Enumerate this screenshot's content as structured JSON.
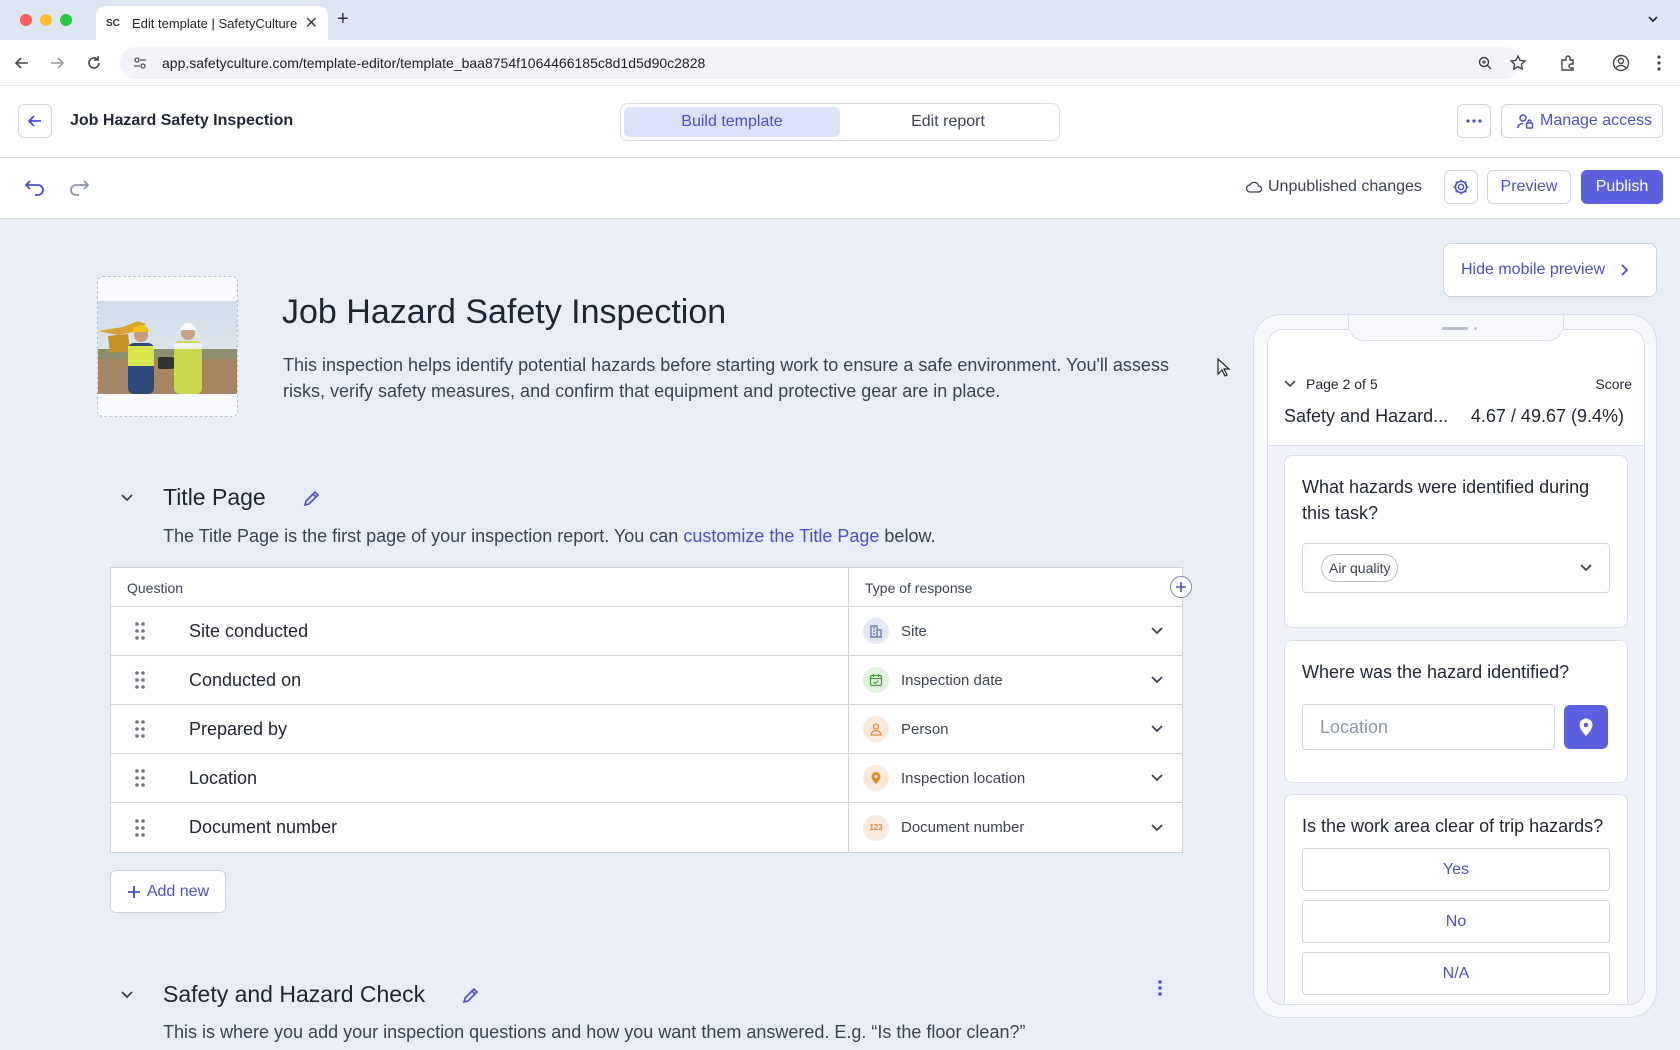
{
  "browser": {
    "tab_title": "Edit template | SafetyCulture",
    "tab_favicon": "SC",
    "url": "app.safetyculture.com/template-editor/template_baa8754f1064466185c8d1d5d90c2828"
  },
  "header": {
    "title": "Job Hazard Safety Inspection",
    "tabs": [
      {
        "label": "Build template",
        "active": true
      },
      {
        "label": "Edit report",
        "active": false
      }
    ],
    "manage_access": "Manage access"
  },
  "toolbar": {
    "status": "Unpublished changes",
    "preview_label": "Preview",
    "publish_label": "Publish"
  },
  "template": {
    "title": "Job Hazard Safety Inspection",
    "description": "This inspection helps identify potential hazards before starting work to ensure a safe environment. You'll assess risks, verify safety measures, and confirm that equipment and protective gear are in place."
  },
  "title_page": {
    "title": "Title Page",
    "desc_prefix": "The Title Page is the first page of your inspection report. You can ",
    "desc_link": "customize the Title Page",
    "desc_suffix": " below.",
    "col_question": "Question",
    "col_type": "Type of response",
    "rows": [
      {
        "question": "Site conducted",
        "type": "Site",
        "icon": "building-icon"
      },
      {
        "question": "Conducted on",
        "type": "Inspection date",
        "icon": "calendar-icon"
      },
      {
        "question": "Prepared by",
        "type": "Person",
        "icon": "person-icon"
      },
      {
        "question": "Location",
        "type": "Inspection location",
        "icon": "pin-icon"
      },
      {
        "question": "Document number",
        "type": "Document number",
        "icon": "number-icon"
      }
    ],
    "add_new": "Add new"
  },
  "safety_section": {
    "title": "Safety and Hazard Check",
    "description": "This is where you add your inspection questions and how you want them answered. E.g. “Is the floor clean?”"
  },
  "mobile_preview": {
    "hide_label": "Hide mobile preview",
    "page_indicator": "Page 2 of 5",
    "score_label": "Score",
    "section_title": "Safety and Hazard...",
    "score_value": "4.67 / 49.67 (9.4%)",
    "q1": "What hazards were identified during this task?",
    "q1_chip": "Air quality",
    "q2": "Where was the hazard identified?",
    "q2_placeholder": "Location",
    "q3": "Is the work area clear of trip hazards?",
    "answers": [
      "Yes",
      "No",
      "N/A"
    ]
  },
  "colors": {
    "accent": "#5b5fe0",
    "link": "#4b4fc7",
    "background": "#e9edf6"
  }
}
